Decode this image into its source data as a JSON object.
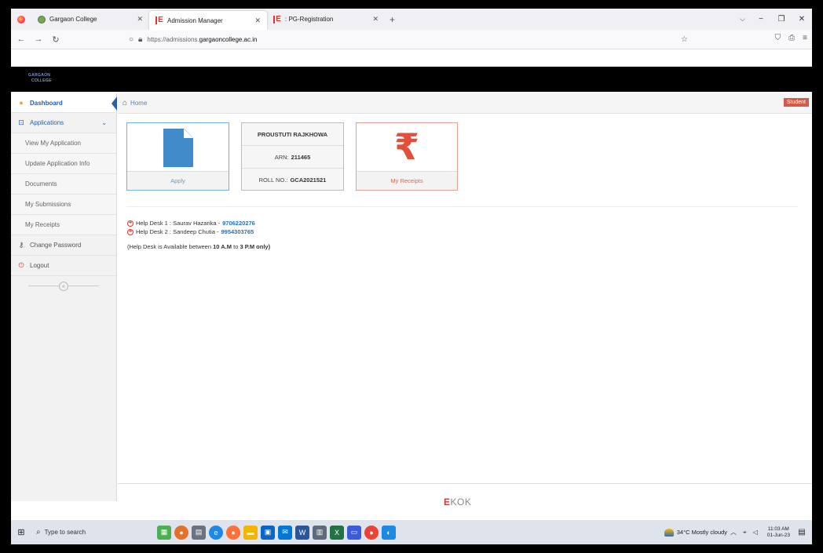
{
  "browser": {
    "tabs": [
      {
        "label": "Gargaon College",
        "active": false
      },
      {
        "label": "Admission Manager",
        "active": true
      },
      {
        "label": ": PG-Registration",
        "active": false
      }
    ],
    "url_prefix": "https://admissions.",
    "url_host": "gargaoncollege.ac.in"
  },
  "site": {
    "logo_line1": "GARGAON",
    "logo_line2": "COLLEGE"
  },
  "sidebar": {
    "dashboard": "Dashboard",
    "applications": "Applications",
    "sub_items": [
      "View My Application",
      "Update Application Info",
      "Documents",
      "My Submissions",
      "My Receipts"
    ],
    "change_password": "Change Password",
    "logout": "Logout"
  },
  "breadcrumb": {
    "home": "Home",
    "role_badge": "Student"
  },
  "cards": {
    "apply_label": "Apply",
    "student_name": "PROUSTUTI RAJKHOWA",
    "arn_label": "ARN:",
    "arn_value": "211465",
    "roll_label": "ROLL NO.:",
    "roll_value": "GCA2021521",
    "receipts_label": "My Receipts",
    "rupee_symbol": "₹"
  },
  "help": {
    "desk1_text": "Help Desk 1 : Saurav Hazarika -",
    "desk1_phone": "9706220276",
    "desk2_text": "Help Desk 2 : Sandeep Chutia -",
    "desk2_phone": "9954303765",
    "avail_prefix": "(Help Desk is Available between",
    "avail_from": "10 A.M",
    "avail_mid": "to",
    "avail_to": "3 P.M only)"
  },
  "footer": {
    "brand_e": "E",
    "brand_rest": "KOK"
  },
  "taskbar": {
    "search_placeholder": "Type to search",
    "weather": "34°C  Mostly cloudy",
    "time": "11:03 AM",
    "date": "01-Jun-23"
  },
  "colors": {
    "accent_blue": "#428bca",
    "badge_red": "#d15b47",
    "rupee_red": "#e0503a"
  }
}
